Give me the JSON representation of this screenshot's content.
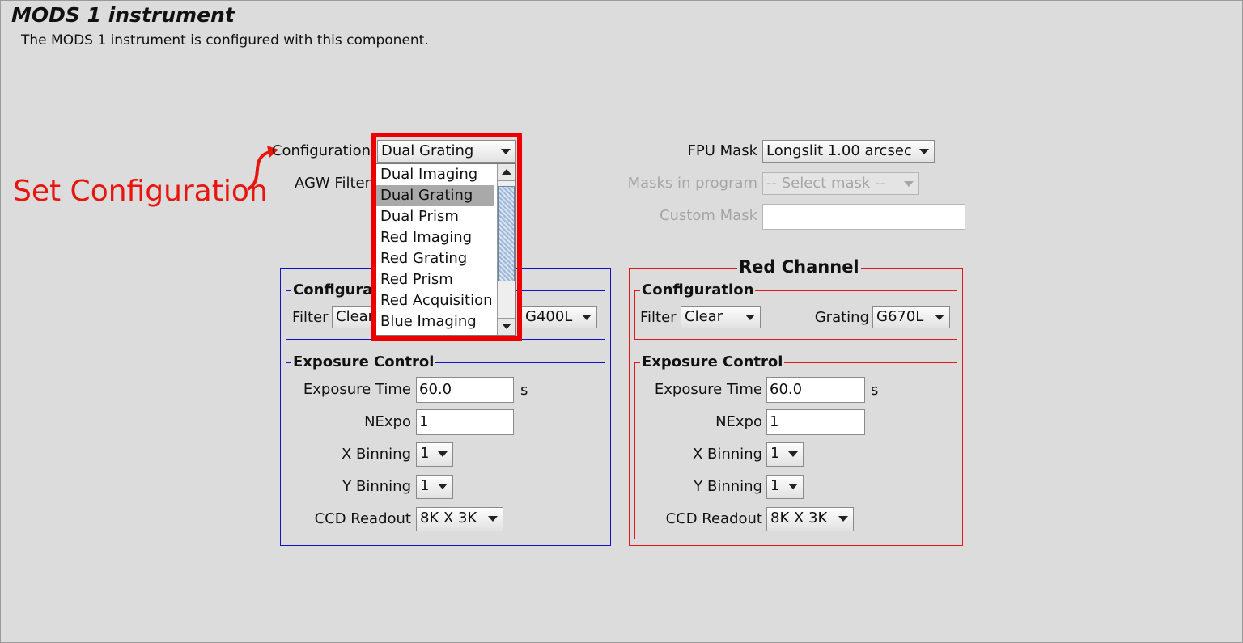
{
  "page": {
    "title": "MODS 1 instrument",
    "subtitle": "The MODS 1 instrument is configured with this component."
  },
  "annotation": {
    "text": "Set Configuration",
    "color": "#e8150e",
    "highlight_color": "#ee0000"
  },
  "configuration": {
    "label": "Configuration",
    "value": "Dual Grating",
    "options": [
      "Dual Imaging",
      "Dual Grating",
      "Dual Prism",
      "Red Imaging",
      "Red Grating",
      "Red Prism",
      "Red Acquisition",
      "Blue Imaging"
    ],
    "selected_index": 1
  },
  "agw_filter": {
    "label": "AGW Filter"
  },
  "fpu": {
    "mask_label": "FPU Mask",
    "mask_value": "Longslit 1.00 arcsec",
    "program_label": "Masks in program",
    "program_value": "-- Select mask --",
    "custom_label": "Custom Mask",
    "custom_value": ""
  },
  "blue": {
    "color": "#1010d0",
    "config_legend": "Configura",
    "filter_label": "Filter",
    "filter_value": "Clear",
    "grating_value": "G400L",
    "exposure_legend": "Exposure Control",
    "exposure_time_label": "Exposure Time",
    "exposure_time": "60.0",
    "unit": "s",
    "nexpo_label": "NExpo",
    "nexpo": "1",
    "xbin_label": "X Binning",
    "xbin": "1",
    "ybin_label": "Y Binning",
    "ybin": "1",
    "ccd_label": "CCD Readout",
    "ccd": "8K X 3K"
  },
  "red": {
    "color": "#e01818",
    "title": "Red Channel",
    "config_legend": "Configuration",
    "filter_label": "Filter",
    "filter_value": "Clear",
    "grating_label": "Grating",
    "grating_value": "G670L",
    "exposure_legend": "Exposure Control",
    "exposure_time_label": "Exposure Time",
    "exposure_time": "60.0",
    "unit": "s",
    "nexpo_label": "NExpo",
    "nexpo": "1",
    "xbin_label": "X Binning",
    "xbin": "1",
    "ybin_label": "Y Binning",
    "ybin": "1",
    "ccd_label": "CCD Readout",
    "ccd": "8K X 3K"
  }
}
